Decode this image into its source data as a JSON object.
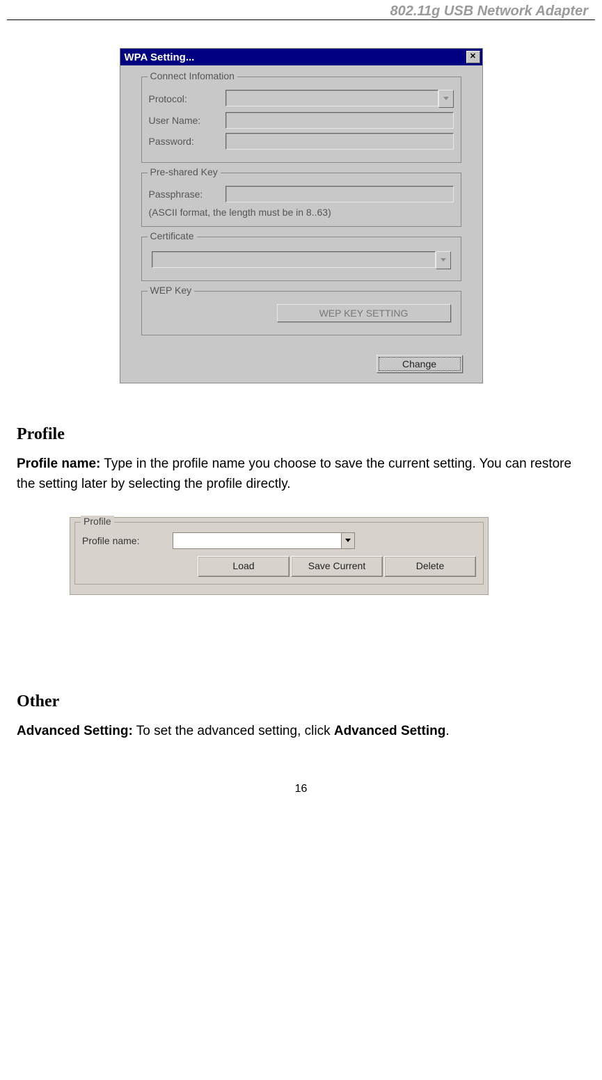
{
  "header": {
    "title": "802.11g USB Network Adapter"
  },
  "wpa_dialog": {
    "title": "WPA Setting...",
    "connect_info": {
      "legend": "Connect Infomation",
      "protocol_label": "Protocol:",
      "username_label": "User Name:",
      "password_label": "Password:"
    },
    "psk": {
      "legend": "Pre-shared Key",
      "passphrase_label": "Passphrase:",
      "hint": "(ASCII format, the length must be in 8..63)"
    },
    "certificate": {
      "legend": "Certificate"
    },
    "wep": {
      "legend": "WEP Key",
      "button": "WEP KEY SETTING"
    },
    "change_button": "Change"
  },
  "sections": {
    "profile": {
      "heading": "Profile",
      "text_bold": "Profile name:",
      "text": " Type in the profile name you choose to save the current setting. You can restore the setting later by selecting the profile directly."
    },
    "other": {
      "heading": "Other",
      "text_bold": "Advanced Setting:",
      "text1": " To set the advanced setting, click ",
      "text_bold2": "Advanced Setting",
      "text2": "."
    }
  },
  "profile_dialog": {
    "legend": "Profile",
    "name_label": "Profile name:",
    "load": "Load",
    "save": "Save Current",
    "delete": "Delete"
  },
  "page_number": "16"
}
